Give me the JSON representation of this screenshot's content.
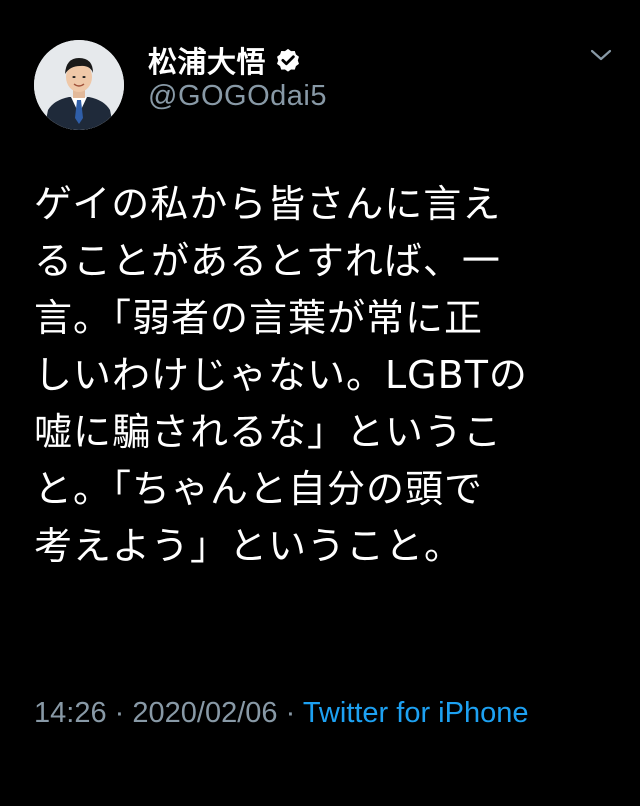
{
  "tweet": {
    "display_name": "松浦大悟",
    "handle": "@GOGOdai5",
    "verified_icon": "verified-badge-icon",
    "menu_icon": "chevron-down-icon",
    "text": "ゲイの私から皆さんに言え\nることがあるとすれば、一\n言。「弱者の言葉が常に正\nしいわけじゃない。LGBTの\n嘘に騙されるな」というこ\nと。「ちゃんと自分の頭で\n考えよう」ということ。",
    "time": "14:26",
    "date": "2020/02/06",
    "separator": "·",
    "source": "Twitter for iPhone"
  },
  "colors": {
    "background": "#000000",
    "text": "#ffffff",
    "secondary": "#8899a6",
    "link": "#1da1f2"
  }
}
